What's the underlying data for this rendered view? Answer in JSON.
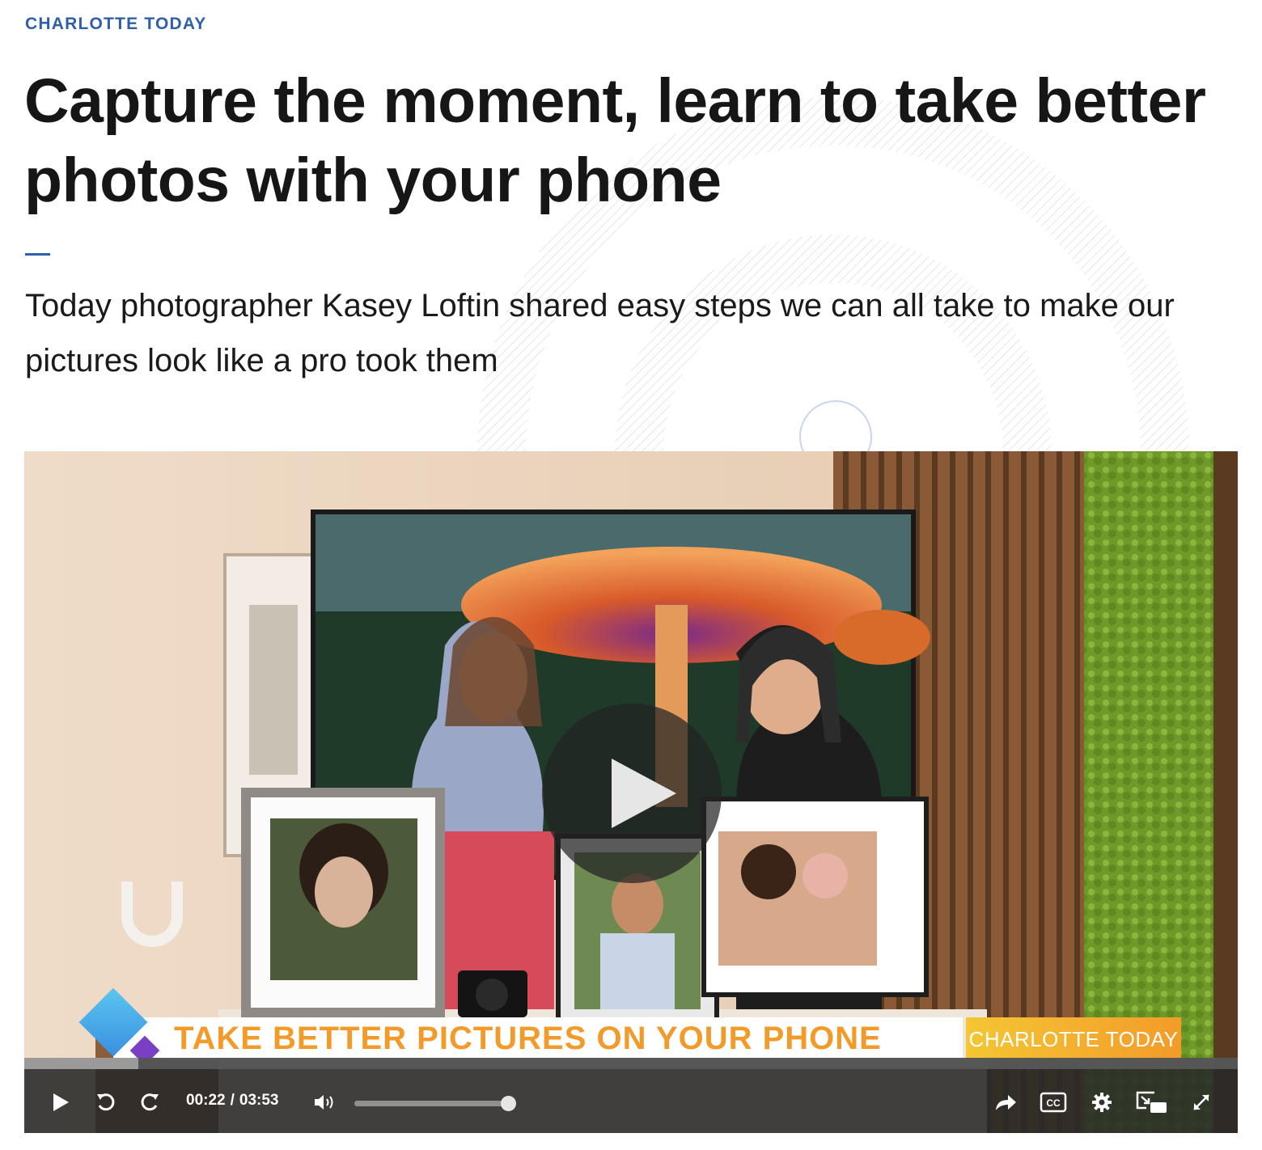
{
  "article": {
    "section_label": "CHARLOTTE TODAY",
    "headline": "Capture the moment, learn to take better photos with your phone",
    "dek": "Today photographer Kasey Loftin shared easy steps we can all take to make our pictures look like a pro took them",
    "accent_color": "#2f5fa8"
  },
  "video": {
    "lower_third": {
      "headline": "TAKE BETTER PICTURES ON YOUR PHONE",
      "logo": "CHARLOTTE TODAY"
    },
    "player": {
      "current_time": "00:22",
      "separator": "/",
      "duration": "03:53",
      "progress_fraction": 0.094,
      "volume_fraction": 1.0,
      "icons": [
        "play-icon",
        "rewind-icon",
        "forward-icon",
        "volume-icon",
        "share-icon",
        "cc-icon",
        "gear-icon",
        "picture-in-picture-icon",
        "fullscreen-icon"
      ],
      "cc_label": "CC"
    }
  }
}
